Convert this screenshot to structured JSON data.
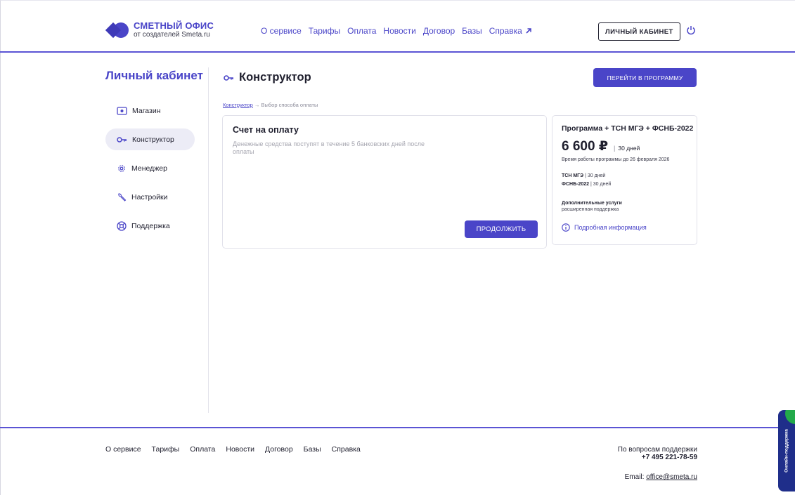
{
  "header": {
    "logo_title": "СМЕТНЫЙ ОФИС",
    "logo_subtitle": "от создателей Smeta.ru",
    "nav": [
      {
        "label": "О сервисе"
      },
      {
        "label": "Тарифы"
      },
      {
        "label": "Оплата"
      },
      {
        "label": "Новости"
      },
      {
        "label": "Договор"
      },
      {
        "label": "Базы"
      },
      {
        "label": "Справка"
      }
    ],
    "cabinet_button": "ЛИЧНЫЙ КАБИНЕТ",
    "accent_color": "#4a45c8"
  },
  "sidebar": {
    "title": "Личный кабинет",
    "items": [
      {
        "label": "Магазин",
        "icon": "store-icon"
      },
      {
        "label": "Конструктор",
        "icon": "key-icon",
        "active": true
      },
      {
        "label": "Менеджер",
        "icon": "gear-icon"
      },
      {
        "label": "Настройки",
        "icon": "wrench-icon"
      },
      {
        "label": "Поддержка",
        "icon": "lifebuoy-icon"
      }
    ]
  },
  "main": {
    "title": "Конструктор",
    "goto_button": "ПЕРЕЙТИ В ПРОГРАММУ",
    "breadcrumb": {
      "link": "Конструктор",
      "separator": "→",
      "current": "Выбор способа оплаты"
    },
    "payment_card": {
      "title": "Счет на оплату",
      "description": "Денежные средства поступят в течение 5 банковских дней после оплаты",
      "continue_button": "ПРОДОЛЖИТЬ"
    },
    "plan_card": {
      "name": "Программа + ТСН МГЭ + ФСНБ-2022",
      "price": "6 600 ₽",
      "separator": "|",
      "period": "30 дней",
      "valid_until": "Время работы программы до 26 февраля 2026",
      "databases": [
        {
          "name": "ТСН МГЭ",
          "period": "30 дней"
        },
        {
          "name": "ФСНБ-2022",
          "period": "30 дней"
        }
      ],
      "extra_title": "Дополнительные услуги",
      "extra_value": "расширенная поддержка",
      "info_link": "Подробная информация"
    }
  },
  "footer": {
    "nav": [
      {
        "label": "О сервисе"
      },
      {
        "label": "Тарифы"
      },
      {
        "label": "Оплата"
      },
      {
        "label": "Новости"
      },
      {
        "label": "Договор"
      },
      {
        "label": "Базы"
      },
      {
        "label": "Справка"
      }
    ],
    "support_label": "По вопросам поддержки",
    "support_phone": "+7 495 221-78-59",
    "email_label": "Email:",
    "email": "office@smeta.ru"
  },
  "chat_tab": {
    "label": "Онлайн-поддержка"
  }
}
